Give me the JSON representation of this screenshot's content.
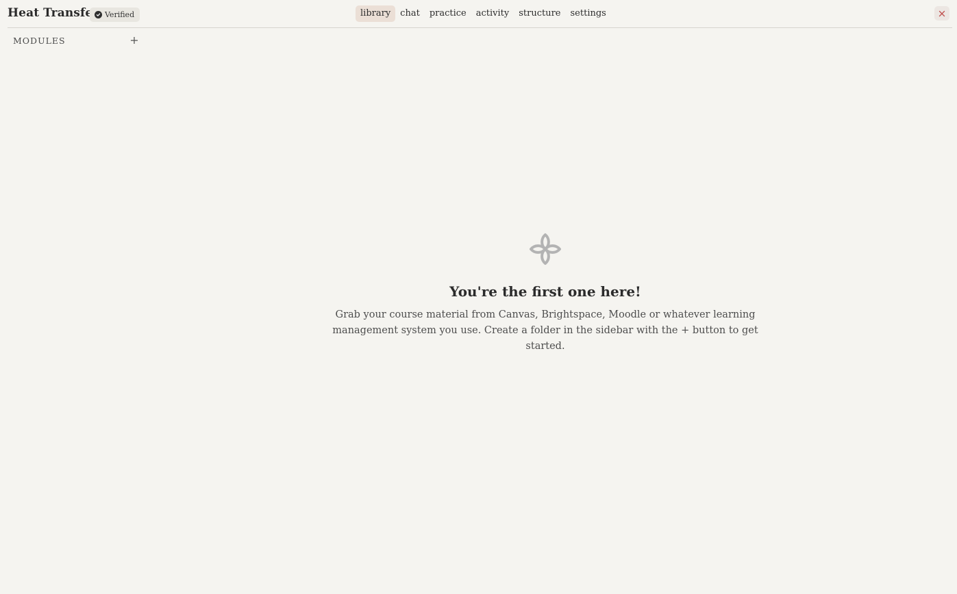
{
  "header": {
    "course_title": "Heat Transfer",
    "verified_label": "Verified",
    "tabs": [
      {
        "label": "library",
        "active": true
      },
      {
        "label": "chat",
        "active": false
      },
      {
        "label": "practice",
        "active": false
      },
      {
        "label": "activity",
        "active": false
      },
      {
        "label": "structure",
        "active": false
      },
      {
        "label": "settings",
        "active": false
      }
    ],
    "close_icon": "close-icon"
  },
  "sidebar": {
    "section_label": "MODULES",
    "add_button_label": "+"
  },
  "empty_state": {
    "icon": "flower-icon",
    "title": "You're the first one here!",
    "description": "Grab your course material from Canvas, Brightspace, Moodle or whatever learning management system you use. Create a folder in the sidebar with the + button to get started."
  },
  "colors": {
    "background": "#f5f4f0",
    "active_tab": "#ebdfd6",
    "close_accent": "#c0504d",
    "icon_gray": "#b3b3b3"
  }
}
